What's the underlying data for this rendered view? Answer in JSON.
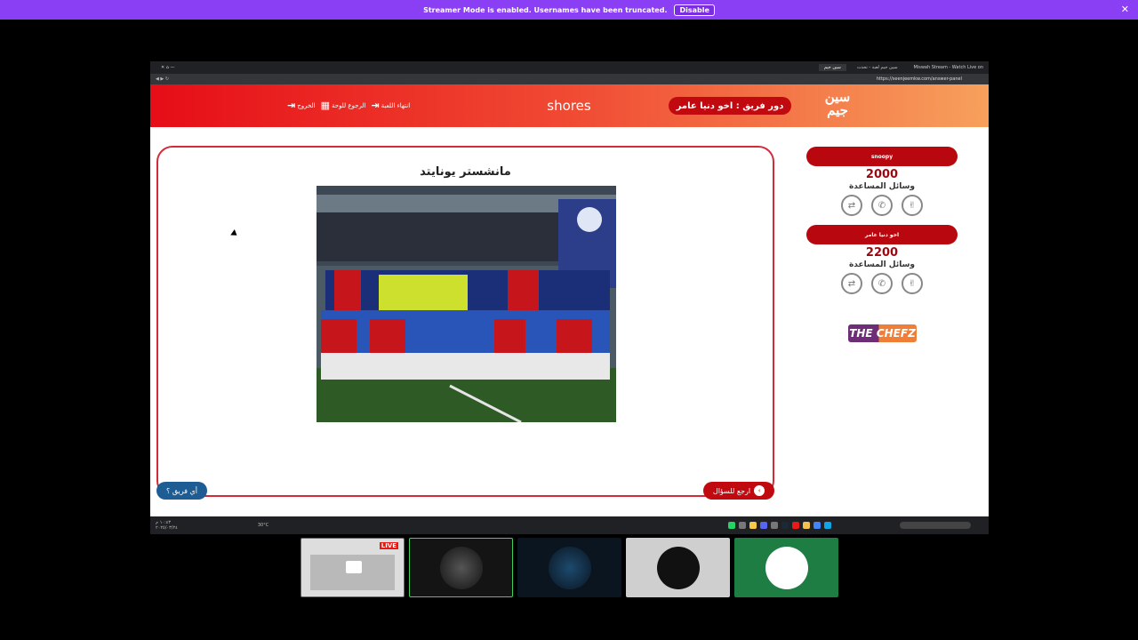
{
  "banner": {
    "text": "Streamer Mode is enabled. Usernames have been truncated.",
    "disable_label": "Disable",
    "close": "✕"
  },
  "browser": {
    "tabs": [
      "سين جيم",
      "سين جيم لعبة - تحدث",
      "Miswah Stream - Watch Live on"
    ],
    "url": "https://seenjeemkw.com/answer-panel"
  },
  "header": {
    "logo": "سين جيم",
    "turn_label": "دور فريق : اخو دنيا عامر",
    "title": "shores",
    "end_game": "انتهاء اللعبة",
    "back_to_board": "الرجوع للوحة",
    "exit": "الخروج"
  },
  "question": {
    "answer": "مانشستر يونايتد",
    "back_button": "ارجع للسؤال",
    "team_button": "أي فريق ؟"
  },
  "teams": [
    {
      "name": "snoopy",
      "score": "2000",
      "aids_label": "وسائل المساعدة"
    },
    {
      "name": "اخو دنيا عامر",
      "score": "2200",
      "aids_label": "وسائل المساعدة"
    }
  ],
  "sponsor": {
    "the": "THE",
    "chefz": "CHEFZ"
  },
  "taskbar": {
    "time": "١٠:٤٣ م",
    "date": "٢٠٢٥/٠٣/٢٤",
    "weather": "30°C"
  },
  "thumbnails": {
    "live_badge": "LIVE"
  },
  "colors": {
    "brand_red": "#e60d17",
    "dark_red": "#b8070e",
    "team_blue": "#1d5d94",
    "streamer_purple": "#8b3ff5"
  }
}
